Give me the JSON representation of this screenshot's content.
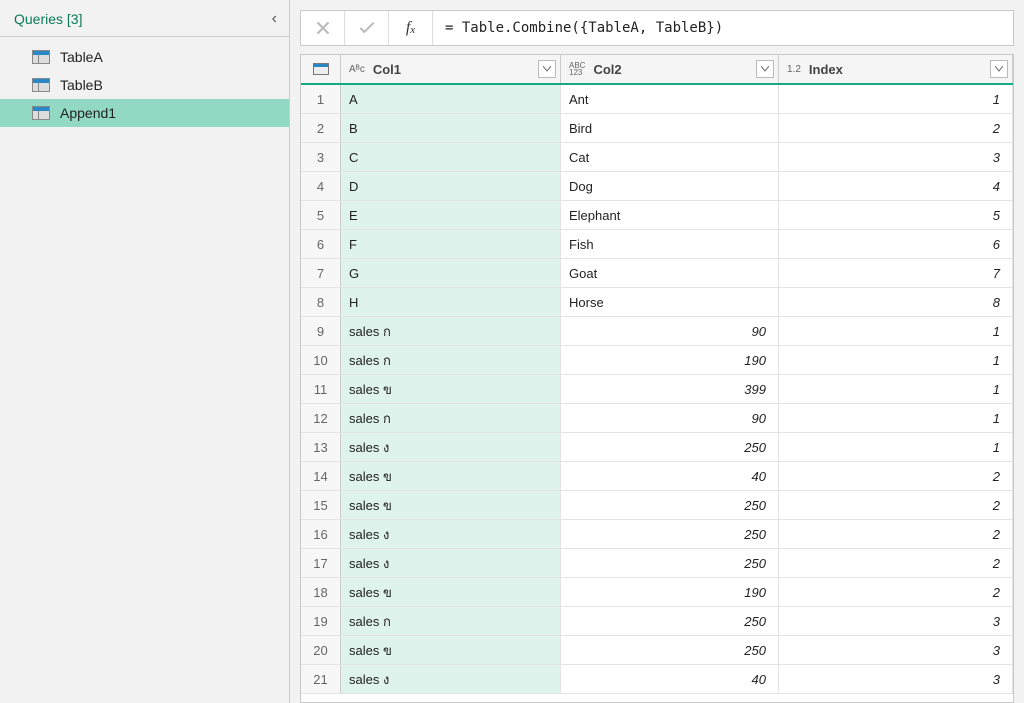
{
  "sidebar": {
    "title": "Queries [3]",
    "items": [
      {
        "label": "TableA"
      },
      {
        "label": "TableB"
      },
      {
        "label": "Append1"
      }
    ],
    "selectedIndex": 2
  },
  "formula": "= Table.Combine({TableA, TableB})",
  "columns": [
    {
      "typeLabel": "Aᴮc",
      "label": "Col1"
    },
    {
      "typeLabel": "ABC\n123",
      "label": "Col2"
    },
    {
      "typeLabel": "1.2",
      "label": "Index"
    }
  ],
  "rows": [
    {
      "n": "1",
      "c1": "A",
      "c2": "Ant",
      "c2num": false,
      "c3": "1"
    },
    {
      "n": "2",
      "c1": "B",
      "c2": "Bird",
      "c2num": false,
      "c3": "2"
    },
    {
      "n": "3",
      "c1": "C",
      "c2": "Cat",
      "c2num": false,
      "c3": "3"
    },
    {
      "n": "4",
      "c1": "D",
      "c2": "Dog",
      "c2num": false,
      "c3": "4"
    },
    {
      "n": "5",
      "c1": "E",
      "c2": "Elephant",
      "c2num": false,
      "c3": "5"
    },
    {
      "n": "6",
      "c1": "F",
      "c2": "Fish",
      "c2num": false,
      "c3": "6"
    },
    {
      "n": "7",
      "c1": "G",
      "c2": "Goat",
      "c2num": false,
      "c3": "7"
    },
    {
      "n": "8",
      "c1": "H",
      "c2": "Horse",
      "c2num": false,
      "c3": "8"
    },
    {
      "n": "9",
      "c1": "sales ก",
      "c2": "90",
      "c2num": true,
      "c3": "1"
    },
    {
      "n": "10",
      "c1": "sales ก",
      "c2": "190",
      "c2num": true,
      "c3": "1"
    },
    {
      "n": "11",
      "c1": "sales ข",
      "c2": "399",
      "c2num": true,
      "c3": "1"
    },
    {
      "n": "12",
      "c1": "sales ก",
      "c2": "90",
      "c2num": true,
      "c3": "1"
    },
    {
      "n": "13",
      "c1": "sales ง",
      "c2": "250",
      "c2num": true,
      "c3": "1"
    },
    {
      "n": "14",
      "c1": "sales ข",
      "c2": "40",
      "c2num": true,
      "c3": "2"
    },
    {
      "n": "15",
      "c1": "sales ข",
      "c2": "250",
      "c2num": true,
      "c3": "2"
    },
    {
      "n": "16",
      "c1": "sales ง",
      "c2": "250",
      "c2num": true,
      "c3": "2"
    },
    {
      "n": "17",
      "c1": "sales ง",
      "c2": "250",
      "c2num": true,
      "c3": "2"
    },
    {
      "n": "18",
      "c1": "sales ข",
      "c2": "190",
      "c2num": true,
      "c3": "2"
    },
    {
      "n": "19",
      "c1": "sales ก",
      "c2": "250",
      "c2num": true,
      "c3": "3"
    },
    {
      "n": "20",
      "c1": "sales ข",
      "c2": "250",
      "c2num": true,
      "c3": "3"
    },
    {
      "n": "21",
      "c1": "sales ง",
      "c2": "40",
      "c2num": true,
      "c3": "3"
    }
  ]
}
